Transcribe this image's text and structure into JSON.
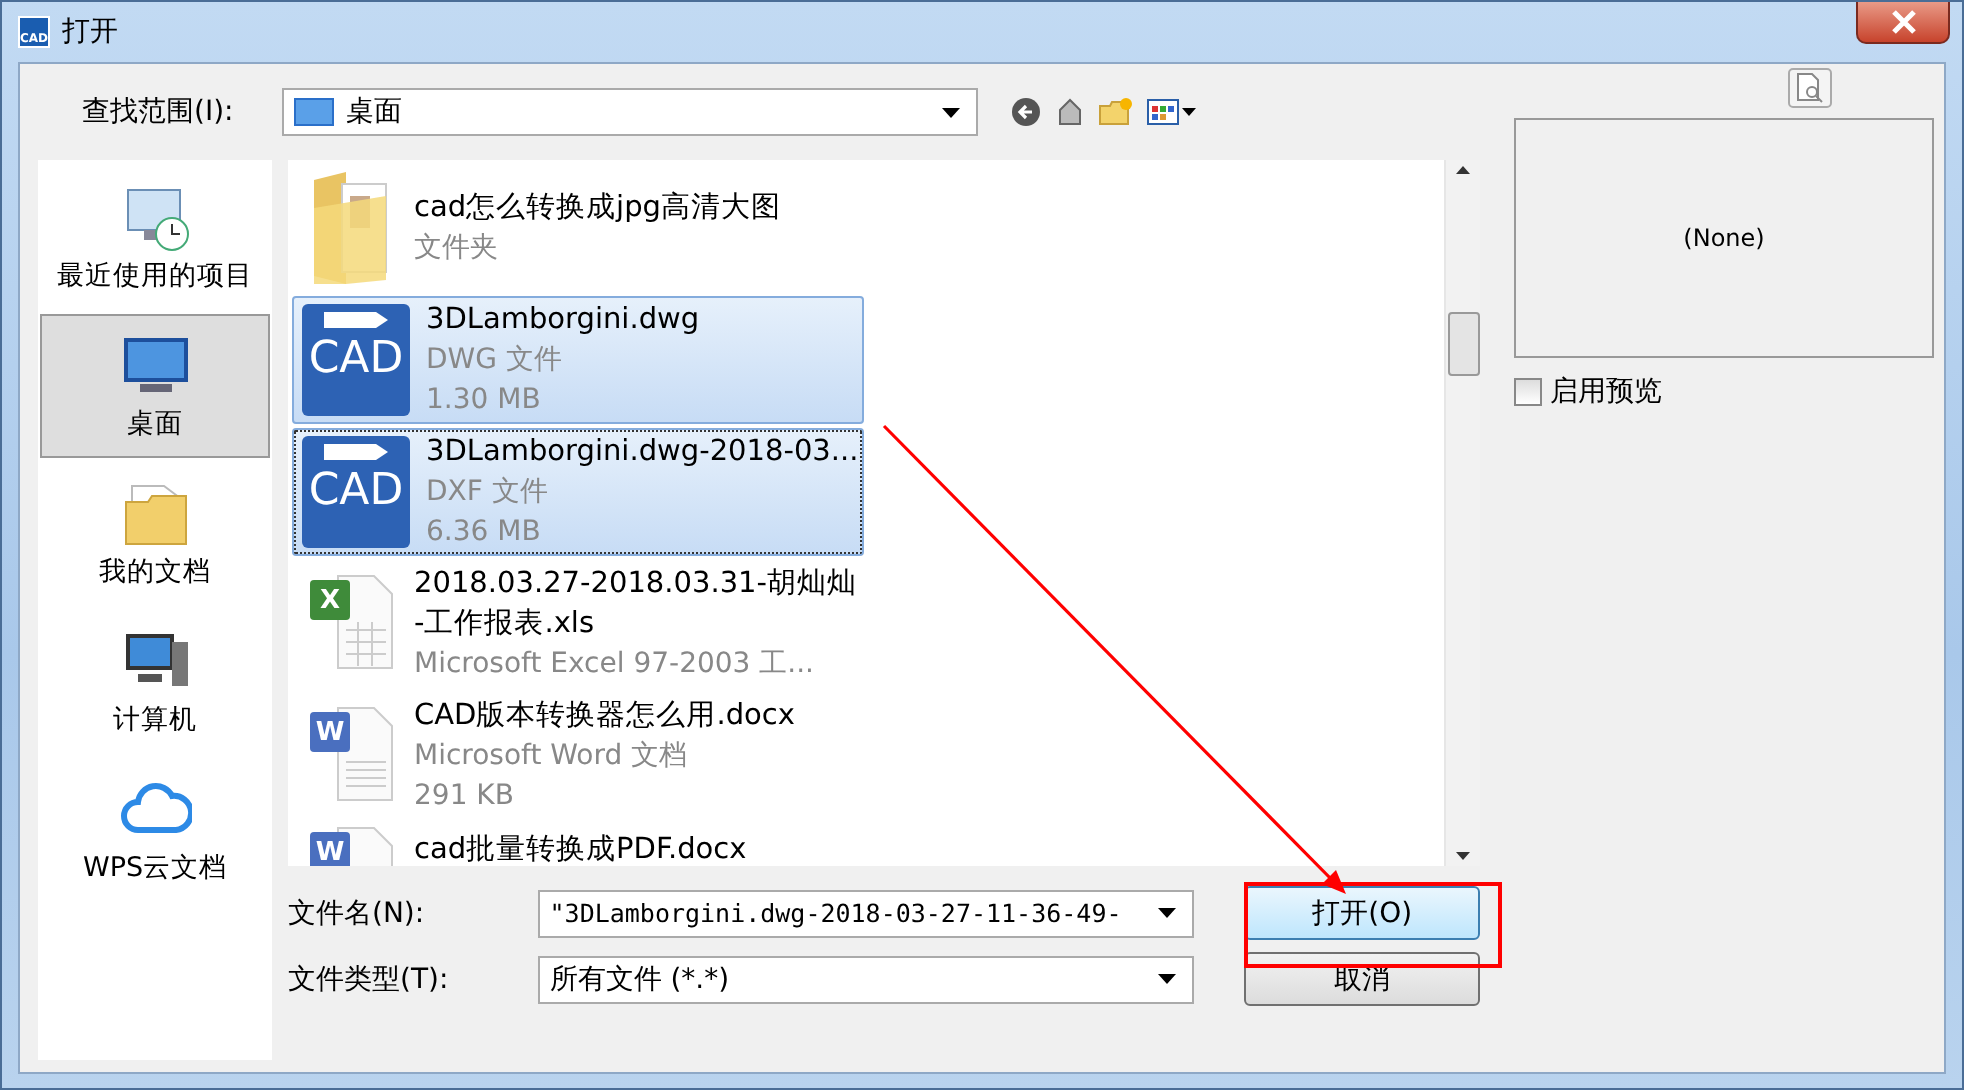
{
  "window": {
    "title": "打开",
    "app_badge": "CAD"
  },
  "look_in": {
    "label": "查找范围(I):",
    "value": "桌面"
  },
  "places": [
    {
      "kind": "recent",
      "label": "最近使用的项目",
      "selected": false
    },
    {
      "kind": "desktop",
      "label": "桌面",
      "selected": true
    },
    {
      "kind": "documents",
      "label": "我的文档",
      "selected": false
    },
    {
      "kind": "computer",
      "label": "计算机",
      "selected": false
    },
    {
      "kind": "cloud",
      "label": "WPS云文档",
      "selected": false
    }
  ],
  "files": [
    {
      "kind": "folder",
      "name": "cad怎么转换成jpg高清大图",
      "type": "文件夹",
      "selected": false
    },
    {
      "kind": "cad",
      "badge": "CAD",
      "name": "3DLamborgini.dwg",
      "type": "DWG 文件",
      "size": "1.30 MB",
      "selected": true
    },
    {
      "kind": "cad",
      "badge": "CAD",
      "name": "3DLamborgini.dwg-2018-03...",
      "type": "DXF 文件",
      "size": "6.36 MB",
      "selected": true
    },
    {
      "kind": "excel",
      "badge": "X",
      "name": "2018.03.27-2018.03.31-胡灿灿\n-工作报表.xls",
      "type": "Microsoft Excel 97-2003 工...",
      "selected": false
    },
    {
      "kind": "word",
      "badge": "W",
      "name": "CAD版本转换器怎么用.docx",
      "type": "Microsoft Word 文档",
      "size": "291 KB",
      "selected": false
    },
    {
      "kind": "word",
      "badge": "W",
      "name": "cad批量转换成PDF.docx",
      "selected": false
    }
  ],
  "preview": {
    "text": "(None)",
    "checkbox_label": "启用预览",
    "checked": false
  },
  "file_name": {
    "label": "文件名(N):",
    "value": "\"3DLamborgini.dwg-2018-03-27-11-36-49-"
  },
  "file_type": {
    "label": "文件类型(T):",
    "value": "所有文件 (*.*)"
  },
  "buttons": [
    {
      "label": "打开(O)",
      "kind": "default"
    },
    {
      "label": "取消",
      "kind": "normal"
    }
  ]
}
